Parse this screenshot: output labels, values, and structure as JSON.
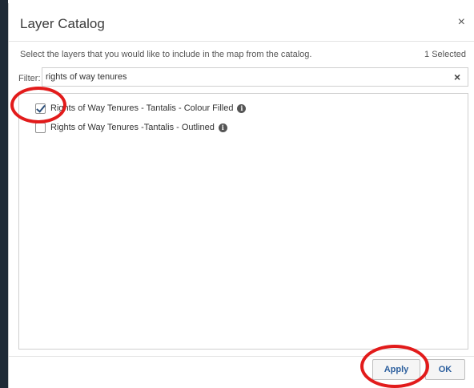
{
  "dialog": {
    "title": "Layer Catalog",
    "close_symbol": "×",
    "instructions": "Select the layers that you would like to include in the map from the catalog.",
    "selected_count": "1 Selected"
  },
  "filter": {
    "label": "Filter:",
    "value": "rights of way tenures",
    "clear_symbol": "×"
  },
  "layers": [
    {
      "label": "Rights of Way Tenures - Tantalis - Colour Filled",
      "checked": true,
      "info_icon": "info-icon"
    },
    {
      "label": "Rights of Way Tenures -Tantalis - Outlined",
      "checked": false,
      "info_icon": "info-icon"
    }
  ],
  "buttons": {
    "apply": "Apply",
    "ok": "OK"
  },
  "colors": {
    "annotation": "#e21b1b",
    "button_text": "#2c5f9e"
  }
}
